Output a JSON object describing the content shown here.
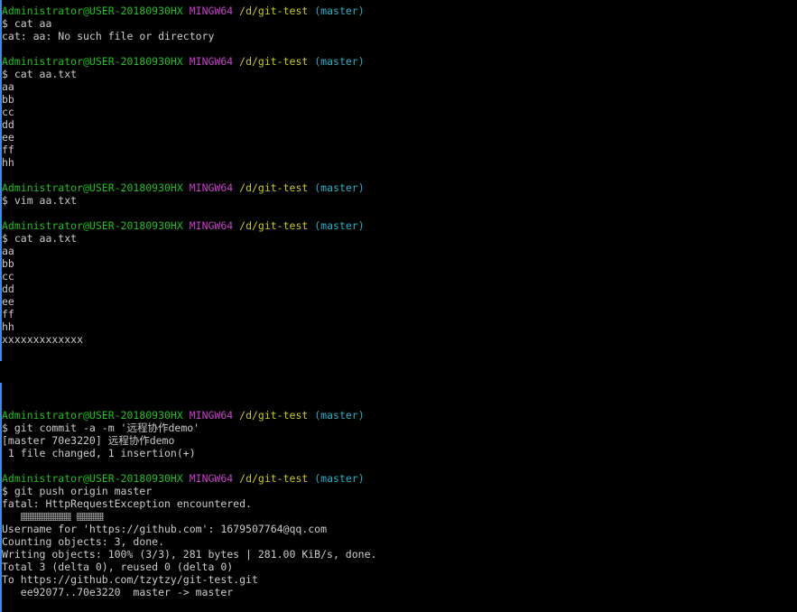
{
  "prompt": {
    "user": "Administrator@USER-20180930HX",
    "shell": "MINGW64",
    "path": "/d/git-test",
    "branch": "(master)"
  },
  "blocks": [
    {
      "command": "$ cat aa",
      "output": [
        "cat: aa: No such file or directory"
      ]
    },
    {
      "command": "$ cat aa.txt",
      "output": [
        "aa",
        "bb",
        "cc",
        "dd",
        "ee",
        "ff",
        "hh"
      ]
    },
    {
      "command": "$ vim aa.txt",
      "output": []
    },
    {
      "command": "$ cat aa.txt",
      "output": [
        "aa",
        "bb",
        "cc",
        "dd",
        "ee",
        "ff",
        "hh",
        "xxxxxxxxxxxxx"
      ]
    },
    {
      "command": "$ git commit -a -m '远程协作demo'",
      "output": [
        "[master 70e3220] 远程协作demo",
        " 1 file changed, 1 insertion(+)"
      ]
    },
    {
      "command": "$ git push origin master",
      "output_before_glyphs": [
        "fatal: HttpRequestException encountered."
      ],
      "output": [
        "Username for 'https://github.com': 1679507764@qq.com",
        "Counting objects: 3, done.",
        "Writing objects: 100% (3/3), 281 bytes | 281.00 KiB/s, done.",
        "Total 3 (delta 0), reused 0 (delta 0)",
        "To https://github.com/tzytzy/git-test.git",
        "   ee92077..70e3220  master -> master"
      ]
    }
  ],
  "colors": {
    "background": "#000000",
    "text": "#cbcbcb",
    "user": "#1fbf1f",
    "shell": "#c740c7",
    "path": "#c8c82a",
    "branch": "#22b2c6",
    "cursor_bar": "#3a8fd8"
  }
}
